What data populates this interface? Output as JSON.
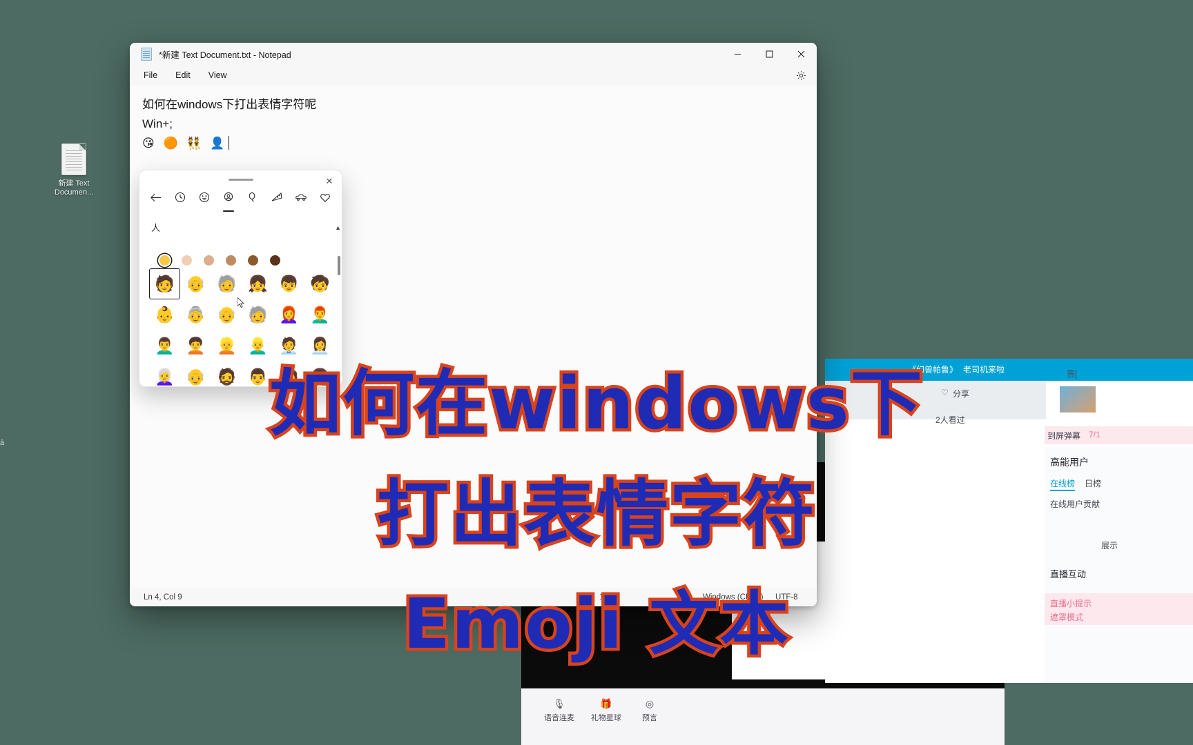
{
  "desktop": {
    "background_color": "#4d6b62",
    "icons": [
      {
        "name": "text-document",
        "label_line1": "新建 Text",
        "label_line2": "Documen..."
      }
    ],
    "edge_fragment": "ā"
  },
  "notepad": {
    "title": "*新建 Text Document.txt - Notepad",
    "app_icon": "notepad-icon",
    "window_controls": [
      {
        "name": "minimize",
        "glyph": "–"
      },
      {
        "name": "maximize",
        "glyph": "□"
      },
      {
        "name": "close",
        "glyph": "✕"
      }
    ],
    "menu": [
      {
        "name": "file",
        "label": "File"
      },
      {
        "name": "edit",
        "label": "Edit"
      },
      {
        "name": "view",
        "label": "View"
      }
    ],
    "settings_icon": "gear-icon",
    "document": {
      "lines": [
        "如何在windows下打出表情字符呢",
        "",
        "Win+;",
        "😘 🟠 👯 👤"
      ]
    },
    "statusbar": {
      "position": "Ln 4, Col 9",
      "zoom": "100%",
      "line_ending": "Windows (CRLF)",
      "encoding": "UTF-8"
    }
  },
  "emoji_picker": {
    "grip": "drag-handle",
    "close_label": "✕",
    "tabs": [
      {
        "name": "back",
        "icon": "back-arrow-icon",
        "selected": false
      },
      {
        "name": "recent",
        "icon": "clock-icon",
        "selected": false
      },
      {
        "name": "smileys",
        "icon": "smiley-icon",
        "selected": false
      },
      {
        "name": "people",
        "icon": "people-icon",
        "selected": true
      },
      {
        "name": "celebration",
        "icon": "balloon-icon",
        "selected": false
      },
      {
        "name": "food",
        "icon": "pizza-icon",
        "selected": false
      },
      {
        "name": "transport",
        "icon": "car-icon",
        "selected": false
      },
      {
        "name": "favorites",
        "icon": "heart-icon",
        "selected": false
      }
    ],
    "category_label": "人",
    "skin_tones": [
      {
        "name": "default",
        "color": "#f7c948",
        "selected": true
      },
      {
        "name": "light",
        "color": "#f3ceb6",
        "selected": false
      },
      {
        "name": "medium-light",
        "color": "#ddae8e",
        "selected": false
      },
      {
        "name": "medium",
        "color": "#bd8b63",
        "selected": false
      },
      {
        "name": "medium-dark",
        "color": "#8d5a2b",
        "selected": false
      },
      {
        "name": "dark",
        "color": "#5a3418",
        "selected": false
      }
    ],
    "grid_rows": [
      [
        "🧑",
        "👴",
        "🧓",
        "👧",
        "👦",
        "🧒"
      ],
      [
        "👶",
        "👵",
        "👴",
        "🧓",
        "👩‍🦰",
        "👨‍🦰"
      ],
      [
        "👨‍🦱",
        "🧑‍🦱",
        "👱",
        "👱‍♂️",
        "🧑‍💼",
        "👩‍💼"
      ],
      [
        "👩‍🦳",
        "👴",
        "🧔",
        "👨",
        "🧑",
        "👩"
      ]
    ],
    "selected_cell": {
      "row": 0,
      "col": 0
    },
    "scrollbar": {
      "up_arrow": "▲",
      "thumb": "scroll-thumb"
    },
    "cursor": "mouse-pointer"
  },
  "background_video": {
    "stream_title": "《幻兽帕鲁》",
    "stream_tag": "老司机来啦",
    "actions": [
      {
        "name": "share",
        "label": "分享"
      }
    ],
    "viewers": "2人看过",
    "danmaku_label": "到屏弹幕",
    "danmaku_time": "7/1",
    "panel_title": "高能用户",
    "panel_tabs": [
      {
        "name": "online-rank",
        "label": "在线榜",
        "selected": true
      },
      {
        "name": "day-rank",
        "label": "日榜",
        "selected": false
      }
    ],
    "panel_sub": "在线用户贡献",
    "panel_note": "展示",
    "interaction_title": "直播互动",
    "tip_line1": "直播小提示",
    "tip_line2": "遮罩模式",
    "controls": [
      {
        "name": "voice-link",
        "icon": "mic-icon",
        "label": "语音连麦"
      },
      {
        "name": "gift-planet",
        "icon": "gift-icon",
        "label": "礼物星球"
      },
      {
        "name": "prediction",
        "icon": "target-icon",
        "label": "预言"
      }
    ]
  },
  "subtitle": {
    "line1": "如何在windows下",
    "line2": "打出表情字符",
    "line3": "Emoji 文本",
    "fill_color": "#1f2bb5",
    "stroke_color": "#d9431b"
  }
}
